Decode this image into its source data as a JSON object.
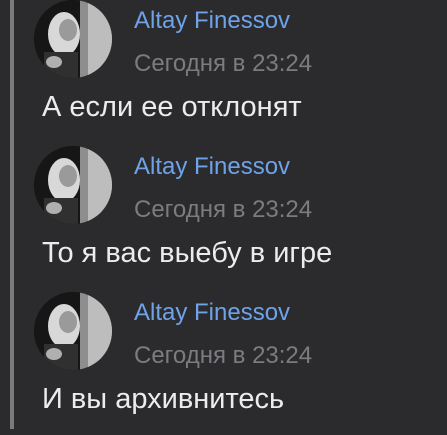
{
  "messages": [
    {
      "author": "Altay Finessov",
      "time": "Сегодня в 23:24",
      "text": "А если ее отклонят",
      "avatar_icon": "user-photo-avatar"
    },
    {
      "author": "Altay Finessov",
      "time": "Сегодня в 23:24",
      "text": "То я вас выебу в игре",
      "avatar_icon": "user-photo-avatar"
    },
    {
      "author": "Altay Finessov",
      "time": "Сегодня в 23:24",
      "text": "И вы архивнитесь",
      "avatar_icon": "user-photo-avatar"
    }
  ],
  "colors": {
    "background": "#2b2b2d",
    "author": "#6fa3e8",
    "time": "#7c7c80",
    "text": "#ececec",
    "quote_bar": "#7a7a7a"
  }
}
